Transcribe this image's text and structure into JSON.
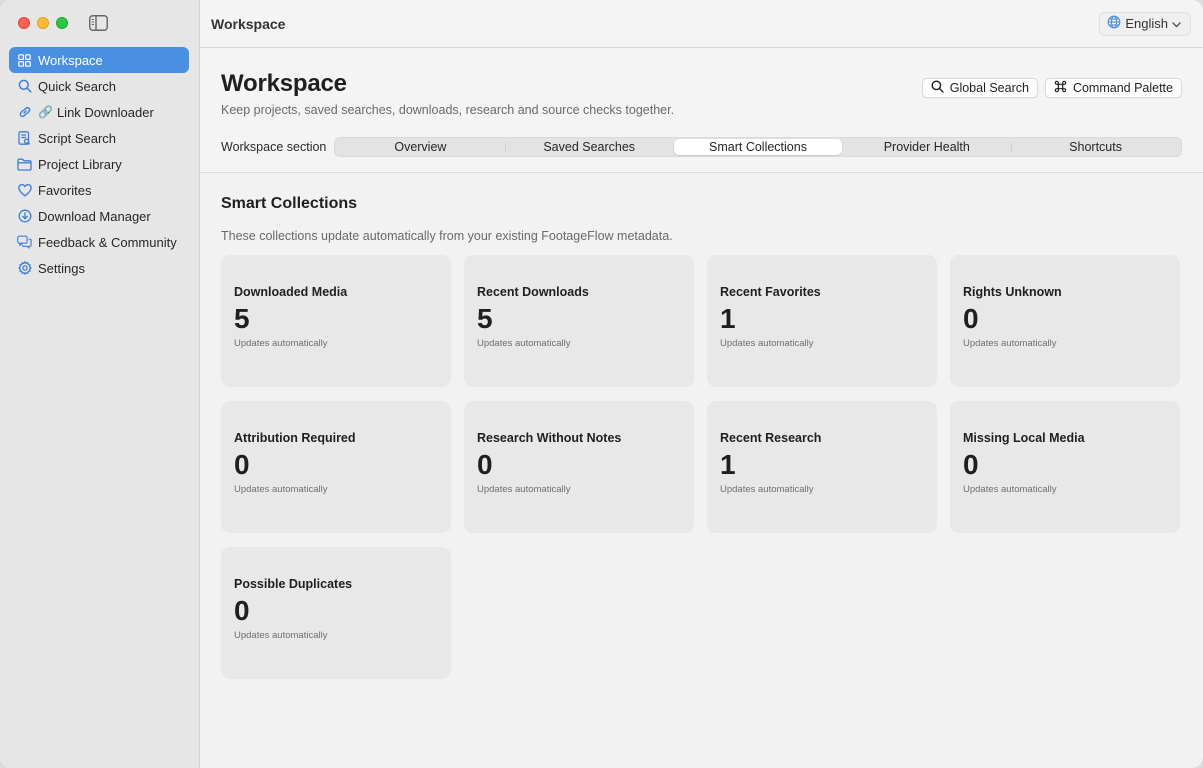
{
  "sidebar": {
    "items": [
      {
        "label": "Workspace",
        "icon": "grid-icon",
        "prefix": ""
      },
      {
        "label": "Quick Search",
        "icon": "search-icon",
        "prefix": ""
      },
      {
        "label": "Link Downloader",
        "icon": "link-icon",
        "prefix": "🔗"
      },
      {
        "label": "Script Search",
        "icon": "script-icon",
        "prefix": ""
      },
      {
        "label": "Project Library",
        "icon": "folder-icon",
        "prefix": ""
      },
      {
        "label": "Favorites",
        "icon": "heart-icon",
        "prefix": ""
      },
      {
        "label": "Download Manager",
        "icon": "download-icon",
        "prefix": ""
      },
      {
        "label": "Feedback & Community",
        "icon": "chat-icon",
        "prefix": ""
      },
      {
        "label": "Settings",
        "icon": "gear-icon",
        "prefix": ""
      }
    ],
    "active_index": 0
  },
  "titlebar": {
    "title": "Workspace",
    "language": "English"
  },
  "header": {
    "title": "Workspace",
    "subtitle": "Keep projects, saved searches, downloads, research and source checks together.",
    "global_search": "Global Search",
    "command_palette": "Command Palette",
    "segment_label": "Workspace section",
    "segments": [
      "Overview",
      "Saved Searches",
      "Smart Collections",
      "Provider Health",
      "Shortcuts"
    ],
    "active_segment": 2
  },
  "section": {
    "title": "Smart Collections",
    "description": "These collections update automatically from your existing FootageFlow metadata."
  },
  "cards": [
    {
      "title": "Downloaded Media",
      "value": "5",
      "note": "Updates automatically"
    },
    {
      "title": "Recent Downloads",
      "value": "5",
      "note": "Updates automatically"
    },
    {
      "title": "Recent Favorites",
      "value": "1",
      "note": "Updates automatically"
    },
    {
      "title": "Rights Unknown",
      "value": "0",
      "note": "Updates automatically"
    },
    {
      "title": "Attribution Required",
      "value": "0",
      "note": "Updates automatically"
    },
    {
      "title": "Research Without Notes",
      "value": "0",
      "note": "Updates automatically"
    },
    {
      "title": "Recent Research",
      "value": "1",
      "note": "Updates automatically"
    },
    {
      "title": "Missing Local Media",
      "value": "0",
      "note": "Updates automatically"
    },
    {
      "title": "Possible Duplicates",
      "value": "0",
      "note": "Updates automatically"
    }
  ],
  "colors": {
    "accent": "#4a90e2",
    "sidebar_icon": "#3d7fd6",
    "close": "#ff5f57",
    "minimize": "#febc2e",
    "zoom": "#28c840"
  }
}
